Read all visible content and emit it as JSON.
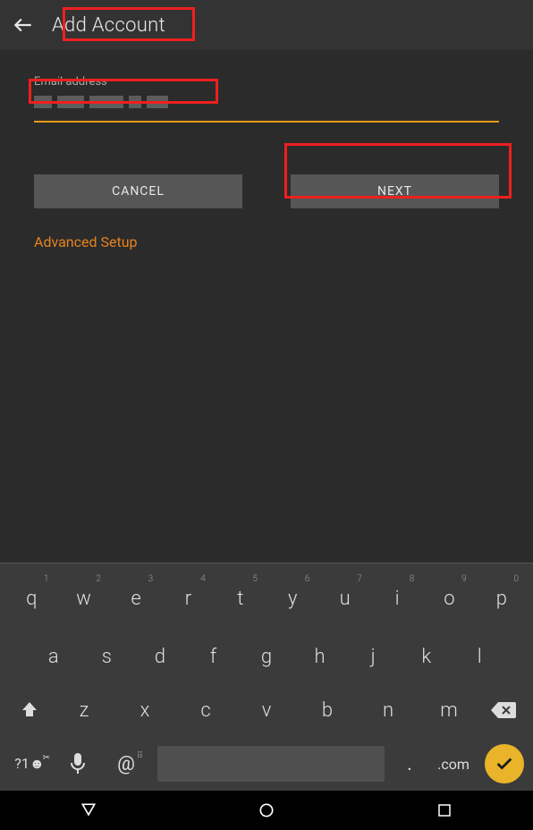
{
  "header": {
    "title": "Add Account"
  },
  "form": {
    "email_label": "Email address",
    "email_value": ""
  },
  "buttons": {
    "cancel": "CANCEL",
    "next": "NEXT",
    "advanced": "Advanced Setup"
  },
  "keyboard": {
    "row1": [
      {
        "k": "q",
        "h": "1"
      },
      {
        "k": "w",
        "h": "2"
      },
      {
        "k": "e",
        "h": "3"
      },
      {
        "k": "r",
        "h": "4"
      },
      {
        "k": "t",
        "h": "5"
      },
      {
        "k": "y",
        "h": "6"
      },
      {
        "k": "u",
        "h": "7"
      },
      {
        "k": "i",
        "h": "8"
      },
      {
        "k": "o",
        "h": "9"
      },
      {
        "k": "p",
        "h": "0"
      }
    ],
    "row2": [
      "a",
      "s",
      "d",
      "f",
      "g",
      "h",
      "j",
      "k",
      "l"
    ],
    "row3": [
      "z",
      "x",
      "c",
      "v",
      "b",
      "n",
      "m"
    ],
    "sym": "?1☻",
    "sym_hint": "✂",
    "at": "@",
    "at_hint": "⠿",
    "dot": ".",
    "com": ".com"
  }
}
